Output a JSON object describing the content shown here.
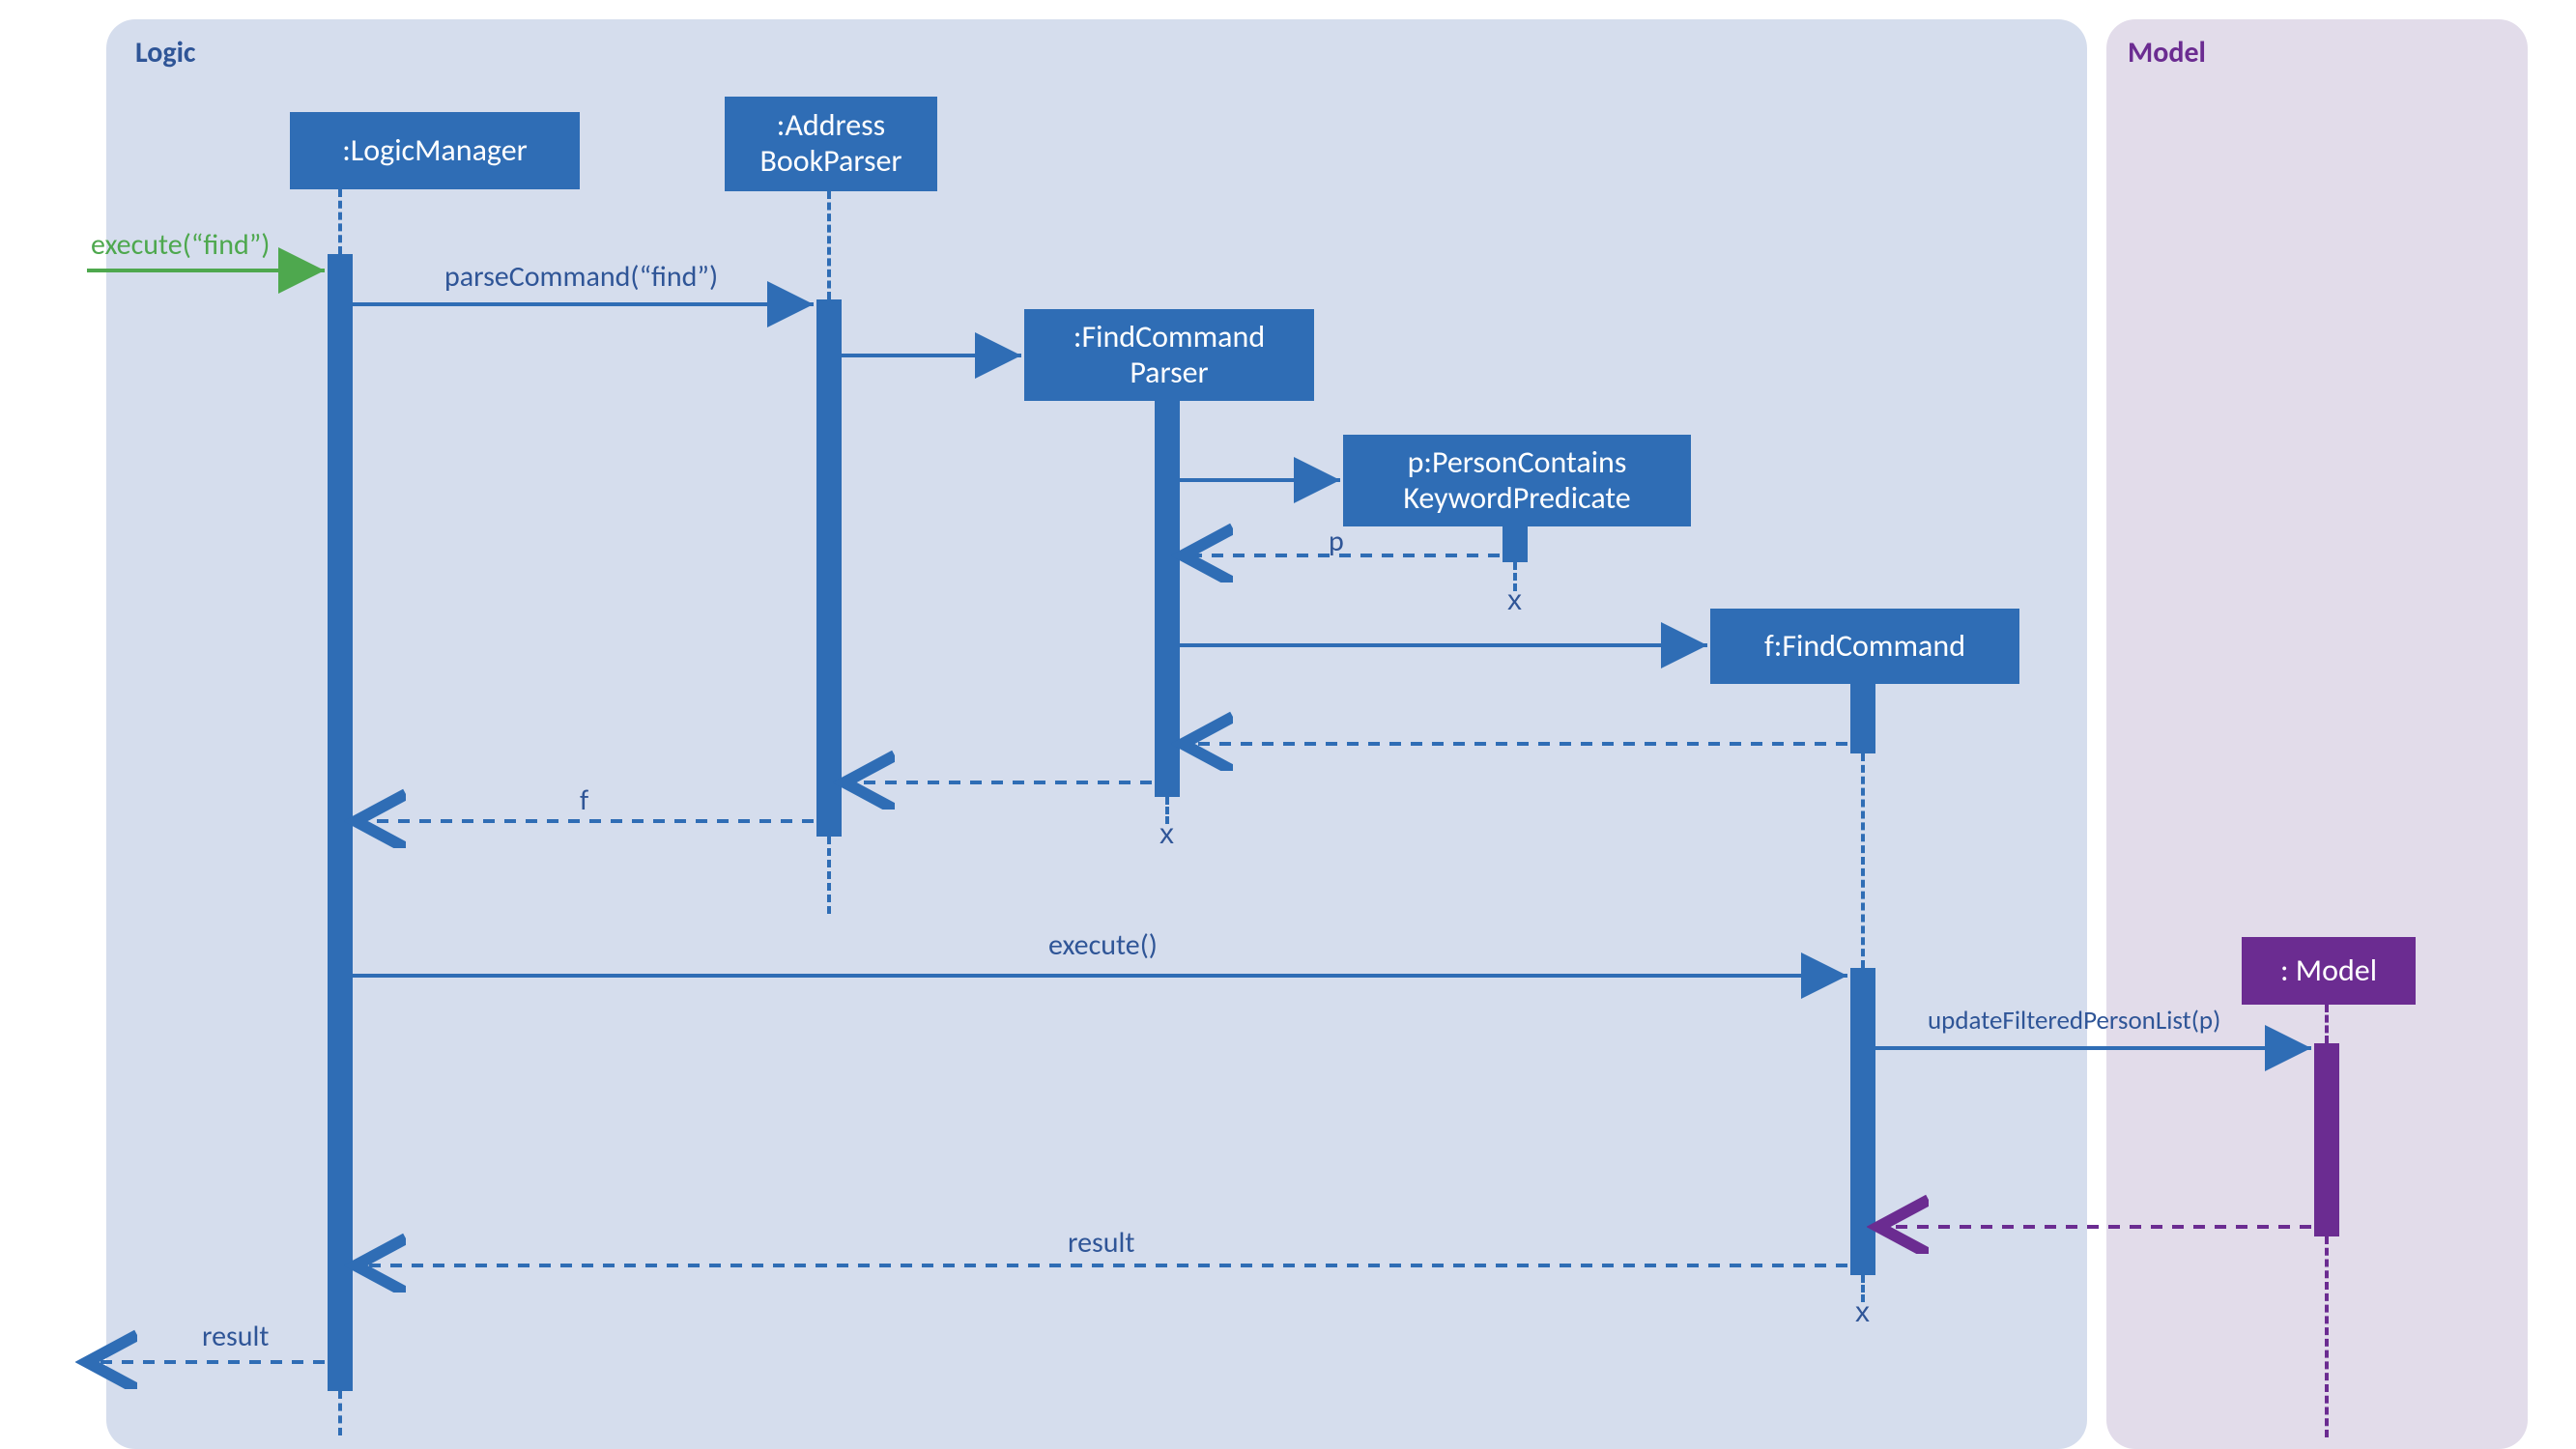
{
  "frames": {
    "logic": "Logic",
    "model": "Model"
  },
  "lifelines": {
    "logicManager": ":LogicManager",
    "addressBookParser": ":Address\nBookParser",
    "findCommandParser": ":FindCommand\nParser",
    "predicate": "p:PersonContains\nKeywordPredicate",
    "findCommand": "f:FindCommand",
    "model": ": Model"
  },
  "messages": {
    "executeFind": "execute(“find”)",
    "parseCommand": "parseCommand(“find”)",
    "returnP": "p",
    "returnF": "f",
    "execute": "execute()",
    "updateFiltered": "updateFilteredPersonList(p)",
    "resultFromFC": "result",
    "resultOut": "result"
  },
  "destroy": {
    "predicate": "x",
    "findCommandParser": "x",
    "findCommand": "x"
  },
  "colors": {
    "logicBg": "#d5dded",
    "modelBg": "#e2dcea",
    "blue": "#2f6db5",
    "darkBlue": "#2f5597",
    "purple": "#6b2c91",
    "green": "#4ea84e"
  },
  "chart_data": {
    "type": "sequence-diagram",
    "frames": [
      {
        "name": "Logic",
        "contains": [
          ":LogicManager",
          ":AddressBookParser",
          ":FindCommandParser",
          "p:PersonContainsKeywordPredicate",
          "f:FindCommand"
        ]
      },
      {
        "name": "Model",
        "contains": [
          ": Model"
        ]
      }
    ],
    "lifelines": [
      ":LogicManager",
      ":AddressBookParser",
      ":FindCommandParser",
      "p:PersonContainsKeywordPredicate",
      "f:FindCommand",
      ": Model"
    ],
    "messages": [
      {
        "from": "external",
        "to": ":LogicManager",
        "label": "execute(\"find\")",
        "type": "call"
      },
      {
        "from": ":LogicManager",
        "to": ":AddressBookParser",
        "label": "parseCommand(\"find\")",
        "type": "call"
      },
      {
        "from": ":AddressBookParser",
        "to": ":FindCommandParser",
        "label": "",
        "type": "create"
      },
      {
        "from": ":FindCommandParser",
        "to": "p:PersonContainsKeywordPredicate",
        "label": "",
        "type": "create"
      },
      {
        "from": "p:PersonContainsKeywordPredicate",
        "to": ":FindCommandParser",
        "label": "p",
        "type": "return"
      },
      {
        "from": ":FindCommandParser",
        "to": "f:FindCommand",
        "label": "",
        "type": "create"
      },
      {
        "from": "f:FindCommand",
        "to": ":FindCommandParser",
        "label": "",
        "type": "return"
      },
      {
        "from": ":FindCommandParser",
        "to": ":AddressBookParser",
        "label": "",
        "type": "return"
      },
      {
        "from": ":AddressBookParser",
        "to": ":LogicManager",
        "label": "f",
        "type": "return"
      },
      {
        "from": ":LogicManager",
        "to": "f:FindCommand",
        "label": "execute()",
        "type": "call"
      },
      {
        "from": "f:FindCommand",
        "to": ": Model",
        "label": "updateFilteredPersonList(p)",
        "type": "call"
      },
      {
        "from": ": Model",
        "to": "f:FindCommand",
        "label": "",
        "type": "return"
      },
      {
        "from": "f:FindCommand",
        "to": ":LogicManager",
        "label": "result",
        "type": "return"
      },
      {
        "from": ":LogicManager",
        "to": "external",
        "label": "result",
        "type": "return"
      }
    ],
    "destructions": [
      "p:PersonContainsKeywordPredicate",
      ":FindCommandParser",
      "f:FindCommand"
    ]
  }
}
